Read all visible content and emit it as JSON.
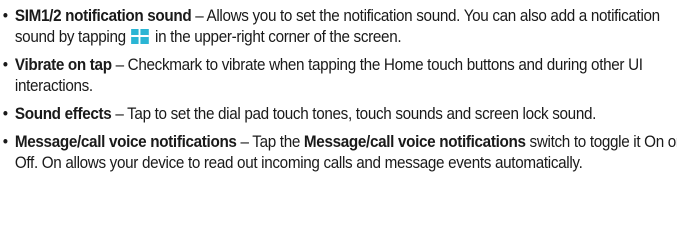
{
  "bullet_char": "•",
  "items": [
    {
      "term": "SIM1/2 notification sound",
      "desc_before_icon": " – Allows you to set the notification sound. You can also add a notification sound by tapping ",
      "icon": "plus-icon",
      "desc_after_icon": " in the upper-right corner of the screen."
    },
    {
      "term": "Vibrate on tap",
      "desc": " – Checkmark to vibrate when tapping the Home touch buttons and during other UI interactions."
    },
    {
      "term": "Sound effects",
      "desc": " – Tap to set the dial pad touch tones, touch sounds and screen lock sound."
    },
    {
      "term": "Message/call voice notifications",
      "desc_part1": " – Tap the ",
      "inline_bold": "Message/call voice notifications",
      "desc_part2": " switch to toggle it On or Off. On allows your device to read out incoming calls and message events automatically."
    }
  ],
  "colors": {
    "text": "#1a1a1a",
    "icon_bg": "#2ab5d4",
    "icon_fg": "#ffffff"
  }
}
